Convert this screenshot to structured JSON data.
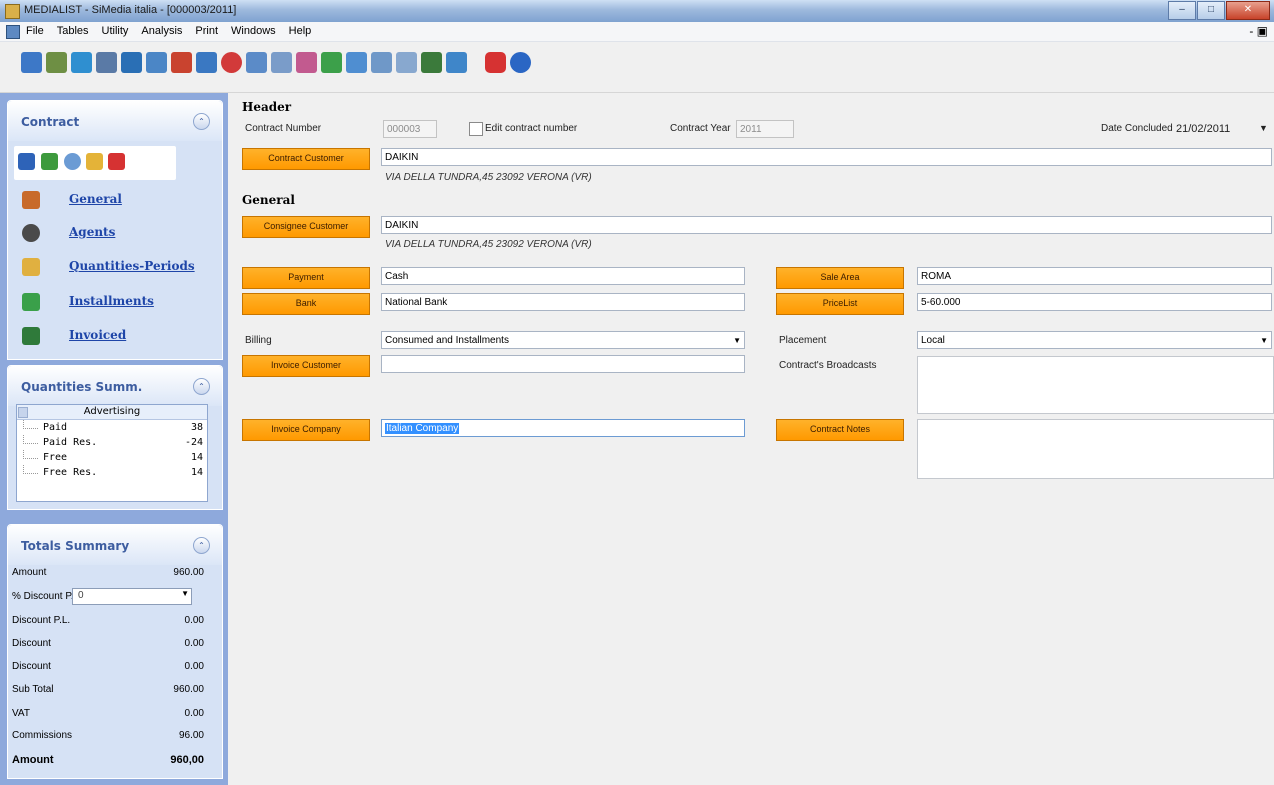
{
  "window": {
    "title": "MEDIALIST - SiMedia italia - [000003/2011]"
  },
  "menu": {
    "items": [
      "File",
      "Tables",
      "Utility",
      "Analysis",
      "Print",
      "Windows",
      "Help"
    ],
    "mdi_controls": "- \u0002 ×"
  },
  "toolbar": {
    "icons": [
      "customers-icon",
      "contracts-icon",
      "agents-icon",
      "schedule-icon",
      "calendar-icon",
      "reports-icon",
      "broadcast-icon",
      "invoice-icon",
      "discount-icon",
      "export-icon",
      "import-icon",
      "documents-icon",
      "print-icon",
      "statistics-icon",
      "archive-icon",
      "settings-icon",
      "map-icon",
      "exit-icon",
      "help-icon"
    ]
  },
  "sidebar": {
    "contract": {
      "title": "Contract",
      "actions": [
        "save-icon",
        "refresh-icon",
        "search-icon",
        "favorite-icon",
        "close-icon"
      ],
      "links": [
        {
          "label": "General",
          "icon": "general-icon"
        },
        {
          "label": "Agents",
          "icon": "agents-icon"
        },
        {
          "label": "Quantities-Periods",
          "icon": "quantities-icon"
        },
        {
          "label": "Installments",
          "icon": "installments-icon"
        },
        {
          "label": "Invoiced",
          "icon": "invoiced-icon"
        }
      ]
    },
    "quantities": {
      "title": "Quantities Summ.",
      "header": "Advertising",
      "rows": [
        {
          "label": "Paid",
          "value": "38"
        },
        {
          "label": "Paid Res.",
          "value": "-24"
        },
        {
          "label": "Free",
          "value": "14"
        },
        {
          "label": "Free Res.",
          "value": "14"
        }
      ]
    },
    "totals": {
      "title": "Totals Summary",
      "amount_label": "Amount",
      "amount_value": "960.00",
      "discount_pl_pct_label": "% Discount P.L.",
      "discount_pl_pct_value": "0",
      "discount_pl_label": "Discount P.L.",
      "discount_pl_value": "0.00",
      "discount1_label": "Discount",
      "discount1_value": "0.00",
      "discount2_label": "Discount",
      "discount2_value": "0.00",
      "subtotal_label": "Sub Total",
      "subtotal_value": "960.00",
      "vat_label": "VAT",
      "vat_value": "0.00",
      "commissions_label": "Commissions",
      "commissions_value": "96.00",
      "total_label": "Amount",
      "total_value": "960,00"
    }
  },
  "form": {
    "header_section": "Header",
    "contract_number_label": "Contract Number",
    "contract_number_value": "000003",
    "edit_contract_number_label": "Edit contract number",
    "contract_year_label": "Contract Year",
    "contract_year_value": "2011",
    "date_concluded_label": "Date Concluded",
    "date_concluded_value": "21/02/2011",
    "contract_customer_button": "Contract Customer",
    "contract_customer_value": "DAIKIN",
    "contract_customer_address": "VIA DELLA TUNDRA,45 23092 VERONA (VR)",
    "general_section": "General",
    "consignee_customer_button": "Consignee Customer",
    "consignee_customer_value": "DAIKIN",
    "consignee_customer_address": "VIA DELLA TUNDRA,45 23092 VERONA (VR)",
    "payment_button": "Payment",
    "payment_value": "Cash",
    "bank_button": "Bank",
    "bank_value": "National Bank",
    "billing_label": "Billing",
    "billing_value": "Consumed and Installments",
    "invoice_customer_button": "Invoice Customer",
    "invoice_customer_value": "",
    "invoice_company_button": "Invoice Company",
    "invoice_company_value": "Italian Company",
    "sale_area_button": "Sale Area",
    "sale_area_value": "ROMA",
    "pricelist_button": "PriceList",
    "pricelist_value": "5-60.000",
    "placement_label": "Placement",
    "placement_value": "Local",
    "broadcasts_label": "Contract's Broadcasts",
    "contract_notes_button": "Contract Notes"
  },
  "colors": {
    "accent_orange": "#ff9900",
    "sidebar_bg": "#8ea9dc",
    "link_blue": "#1e45a8"
  }
}
